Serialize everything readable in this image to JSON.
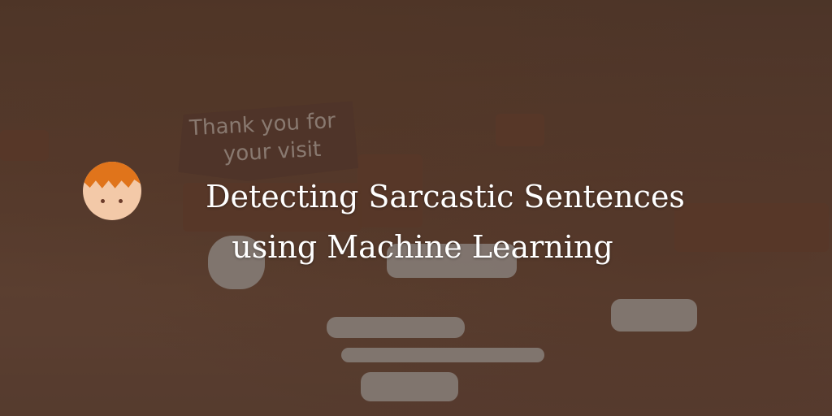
{
  "banner": {
    "title_line1": "Detecting Sarcastic Sentences",
    "title_line2": "using Machine Learning"
  },
  "photo": {
    "sign_line1": "Thank you for",
    "sign_line2": "your visit"
  },
  "avatar": {
    "icon": "cartoon-boy-avatar-icon",
    "hair_color": "#e0741b"
  }
}
